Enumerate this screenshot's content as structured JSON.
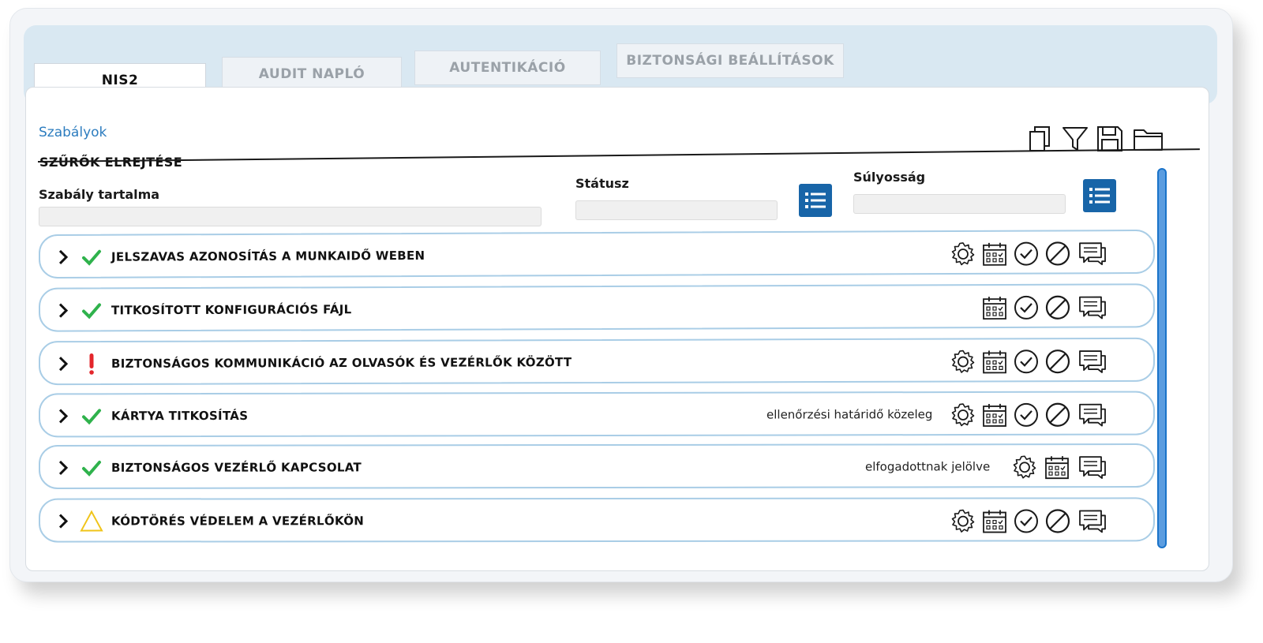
{
  "tabs": [
    {
      "label": "NIS2",
      "active": true
    },
    {
      "label": "AUDIT NAPLÓ",
      "active": false
    },
    {
      "label": "AUTENTIKÁCIÓ",
      "active": false
    },
    {
      "label": "BIZTONSÁGI BEÁLLÍTÁSOK",
      "active": false
    }
  ],
  "breadcrumb": "Szabályok",
  "hide_filters": "SZŰRŐK ELREJTÉSE",
  "toolbar": {
    "icons": [
      "copy-icon",
      "filter-icon",
      "save-icon",
      "folder-icon"
    ]
  },
  "filters": {
    "content_label": "Szabály tartalma",
    "content_value": "",
    "status_label": "Státusz",
    "status_value": "",
    "severity_label": "Súlyosság",
    "severity_value": ""
  },
  "rules": [
    {
      "title": "JELSZAVAS AZONOSÍTÁS A MUNKAIDŐ WEBEN",
      "status": "ok",
      "note": "",
      "actions": [
        "settings",
        "calendar",
        "accept",
        "reject",
        "comment"
      ]
    },
    {
      "title": "TITKOSÍTOTT KONFIGURÁCIÓS FÁJL",
      "status": "ok",
      "note": "",
      "actions": [
        "calendar",
        "accept",
        "reject",
        "comment"
      ]
    },
    {
      "title": "BIZTONSÁGOS KOMMUNIKÁCIÓ AZ OLVASÓK ÉS VEZÉRLŐK KÖZÖTT",
      "status": "critical",
      "note": "",
      "actions": [
        "settings",
        "calendar",
        "accept",
        "reject",
        "comment"
      ]
    },
    {
      "title": "KÁRTYA TITKOSÍTÁS",
      "status": "ok",
      "note": "ellenőrzési határidő közeleg",
      "actions": [
        "settings",
        "calendar",
        "accept",
        "reject",
        "comment"
      ]
    },
    {
      "title": "BIZTONSÁGOS VEZÉRLŐ KAPCSOLAT",
      "status": "ok",
      "note": "elfogadottnak jelölve",
      "actions": [
        "settings",
        "calendar",
        "comment"
      ]
    },
    {
      "title": "KÓDTÖRÉS VÉDELEM A VEZÉRLŐKÖN",
      "status": "warning",
      "note": "",
      "actions": [
        "settings",
        "calendar",
        "accept",
        "reject",
        "comment"
      ]
    }
  ],
  "colors": {
    "accent": "#1865a8",
    "link": "#2d7dbf",
    "ok": "#2fb24c",
    "critical": "#e3262b",
    "warning": "#f0c419",
    "row_border": "#a9cde6"
  }
}
